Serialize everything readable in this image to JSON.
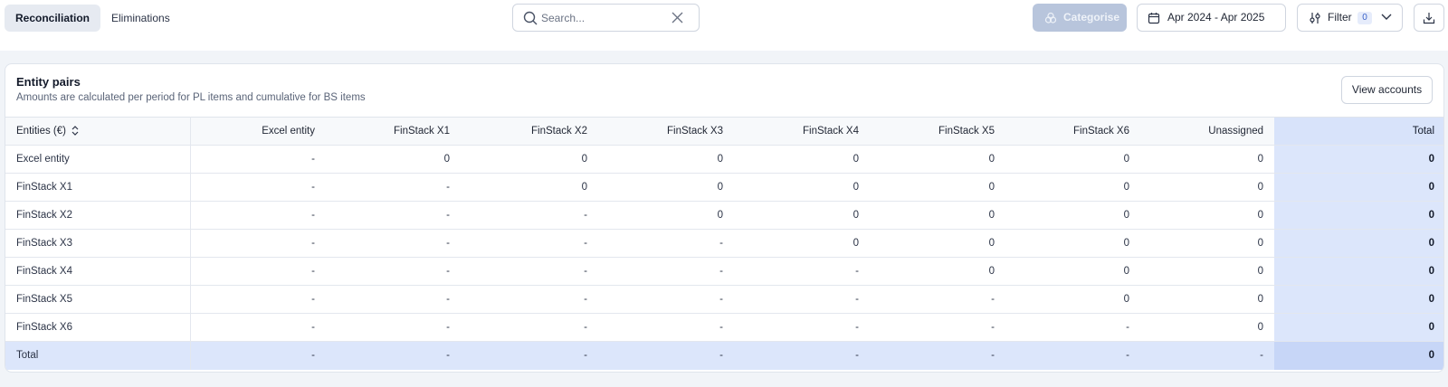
{
  "tabs": [
    {
      "label": "Reconciliation",
      "active": true
    },
    {
      "label": "Eliminations",
      "active": false
    }
  ],
  "search": {
    "placeholder": "Search...",
    "value": ""
  },
  "toolbar": {
    "categorise_label": "Categorise",
    "date_range": "Apr 2024 - Apr 2025",
    "filter_label": "Filter",
    "filter_count": "0"
  },
  "card": {
    "title": "Entity pairs",
    "subtitle": "Amounts are calculated per period for PL items and cumulative for BS items",
    "view_accounts_label": "View accounts"
  },
  "table": {
    "columns": [
      "Entities (€)",
      "Excel entity",
      "FinStack X1",
      "FinStack X2",
      "FinStack X3",
      "FinStack X4",
      "FinStack X5",
      "FinStack X6",
      "Unassigned",
      "Total"
    ],
    "rows": [
      [
        "Excel entity",
        "-",
        "0",
        "0",
        "0",
        "0",
        "0",
        "0",
        "0",
        "0"
      ],
      [
        "FinStack X1",
        "-",
        "-",
        "0",
        "0",
        "0",
        "0",
        "0",
        "0",
        "0"
      ],
      [
        "FinStack X2",
        "-",
        "-",
        "-",
        "0",
        "0",
        "0",
        "0",
        "0",
        "0"
      ],
      [
        "FinStack X3",
        "-",
        "-",
        "-",
        "-",
        "0",
        "0",
        "0",
        "0",
        "0"
      ],
      [
        "FinStack X4",
        "-",
        "-",
        "-",
        "-",
        "-",
        "0",
        "0",
        "0",
        "0"
      ],
      [
        "FinStack X5",
        "-",
        "-",
        "-",
        "-",
        "-",
        "-",
        "0",
        "0",
        "0"
      ],
      [
        "FinStack X6",
        "-",
        "-",
        "-",
        "-",
        "-",
        "-",
        "-",
        "0",
        "0"
      ]
    ],
    "total_row": [
      "Total",
      "-",
      "-",
      "-",
      "-",
      "-",
      "-",
      "-",
      "-",
      "0"
    ]
  },
  "colors": {
    "accent": "#3b63c9",
    "total_bg": "#dce6fb",
    "disabled_button": "#b8c5dc"
  },
  "icons": [
    "search-icon",
    "clear-icon",
    "categorise-icon",
    "calendar-icon",
    "filter-icon",
    "chevron-down-icon",
    "download-icon",
    "sort-icon"
  ]
}
